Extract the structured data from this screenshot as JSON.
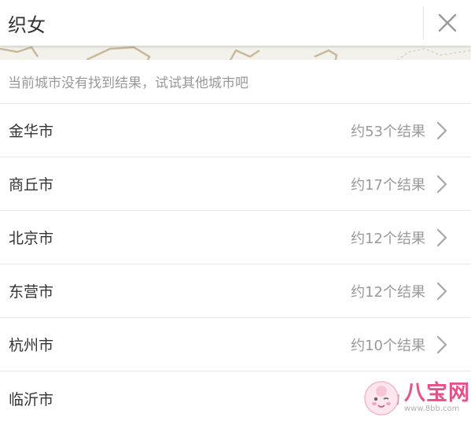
{
  "search": {
    "query": "织女"
  },
  "notice": {
    "text": "当前城市没有找到结果，试试其他城市吧"
  },
  "results": [
    {
      "city": "金华市",
      "count": "约53个结果"
    },
    {
      "city": "商丘市",
      "count": "约17个结果"
    },
    {
      "city": "北京市",
      "count": "约12个结果"
    },
    {
      "city": "东营市",
      "count": "约12个结果"
    },
    {
      "city": "杭州市",
      "count": "约10个结果"
    },
    {
      "city": "临沂市",
      "count": "约"
    }
  ],
  "icons": {
    "close": "close-icon",
    "chevron": "chevron-right-icon"
  },
  "watermark": {
    "brand": "八宝网",
    "url": "www.8bb.com"
  },
  "colors": {
    "watermark_pink": "#e5528a",
    "secondary_text": "#999999",
    "divider": "#e6e6e6"
  }
}
